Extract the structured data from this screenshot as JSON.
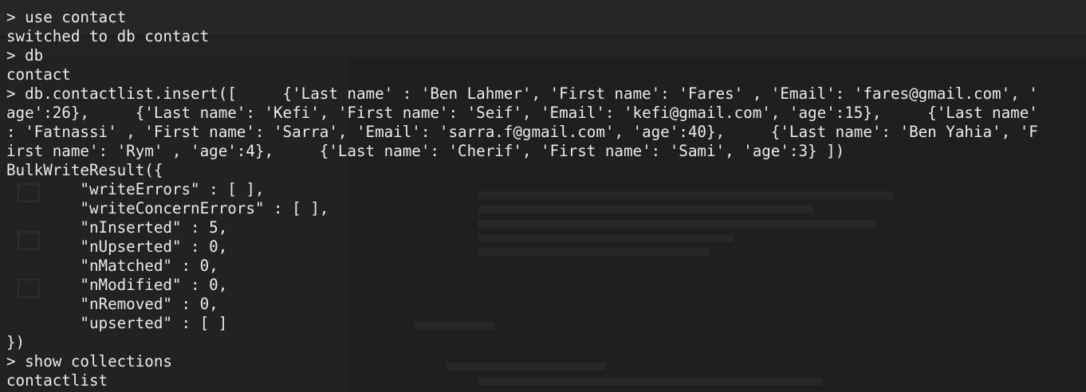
{
  "terminal": {
    "lines": [
      "> use contact",
      "switched to db contact",
      "> db",
      "contact",
      "> db.contactlist.insert([     {'Last name' : 'Ben Lahmer', 'First name': 'Fares' , 'Email': 'fares@gmail.com', '",
      "age':26},     {'Last name': 'Kefi', 'First name': 'Seif', 'Email': 'kefi@gmail.com', 'age':15},     {'Last name'",
      ": 'Fatnassi' , 'First name': 'Sarra', 'Email': 'sarra.f@gmail.com', 'age':40},     {'Last name': 'Ben Yahia', 'F",
      "irst name': 'Rym' , 'age':4},     {'Last name': 'Cherif', 'First name': 'Sami', 'age':3} ])",
      "BulkWriteResult({",
      "        \"writeErrors\" : [ ],",
      "        \"writeConcernErrors\" : [ ],",
      "        \"nInserted\" : 5,",
      "        \"nUpserted\" : 0,",
      "        \"nMatched\" : 0,",
      "        \"nModified\" : 0,",
      "        \"nRemoved\" : 0,",
      "        \"upserted\" : [ ]",
      "})",
      "> show collections",
      "contactlist"
    ]
  },
  "colors": {
    "background": "#1f1f1f",
    "text": "#ebebeb"
  }
}
